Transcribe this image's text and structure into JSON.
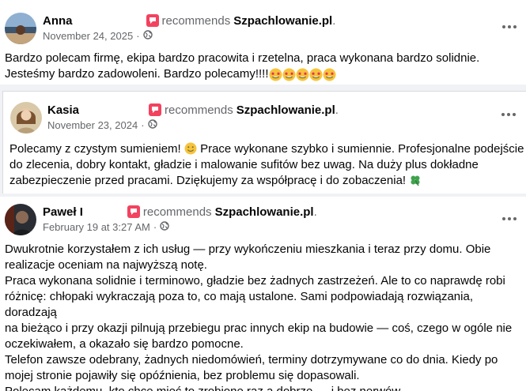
{
  "reviews": [
    {
      "author": "Anna",
      "recommends_label": "recommends",
      "page": "Szpachlowanie.pl",
      "date": "November 24, 2025",
      "separator": "·",
      "text_line1": "Bardzo polecam firmę, ekipa bardzo pracowita i rzetelna, praca wykonana bardzo solidnie.",
      "text_line2": "Jesteśmy bardzo zadowoleni. Bardzo polecamy!!!!",
      "emoji_icon": "star-struck-emoji-icon",
      "emoji_count": 5
    },
    {
      "author": "Kasia",
      "recommends_label": "recommends",
      "page": "Szpachlowanie.pl",
      "date": "November 23, 2024",
      "separator": "·",
      "text_line1a": "Polecamy z czystym sumieniem!",
      "text_line1b": "Prace wykonane szybko i sumiennie. Profesjonalne podejście",
      "text_line2": "do zlecenia, dobry kontakt, gładzie i malowanie sufitów bez uwag. Na duży plus dokładne",
      "text_line3": "zabezpieczenie przed pracami. Dziękujemy za współpracę i do zobaczenia!",
      "emoji_icons": [
        "smiling-face-emoji-icon",
        "four-leaf-clover-emoji-icon"
      ]
    },
    {
      "author": "Paweł I",
      "recommends_label": "recommends",
      "page": "Szpachlowanie.pl",
      "date": "February 19 at 3:27 AM",
      "separator": "·",
      "lines": [
        "Dwukrotnie korzystałem z ich usług — przy wykończeniu mieszkania i teraz przy domu. Obie",
        "realizacje oceniam na najwyższą notę.",
        "Praca wykonana solidnie i terminowo, gładzie bez żadnych zastrzeżeń. Ale to co naprawdę robi",
        "różnicę: chłopaki wykraczają poza to, co mają ustalone. Sami podpowiadają rozwiązania, doradzają",
        "na bieżąco i przy okazji pilnują przebiegu prac innych ekip na budowie — coś, czego w ogóle nie",
        "oczekiwałem, a okazało się bardzo pomocne.",
        "Telefon zawsze odebrany, żadnych niedomówień, terminy dotrzymywane co do dnia. Kiedy po",
        "mojej stronie pojawiły się opóźnienia, bez problemu się dopasowali.",
        "Polecam każdemu, kto chce mieć to zrobione raz a dobrze — i bez nerwów."
      ]
    }
  ],
  "colors": {
    "recommend_icon": "#f3425f",
    "secondary_text": "#65676b",
    "primary_text": "#050505"
  }
}
